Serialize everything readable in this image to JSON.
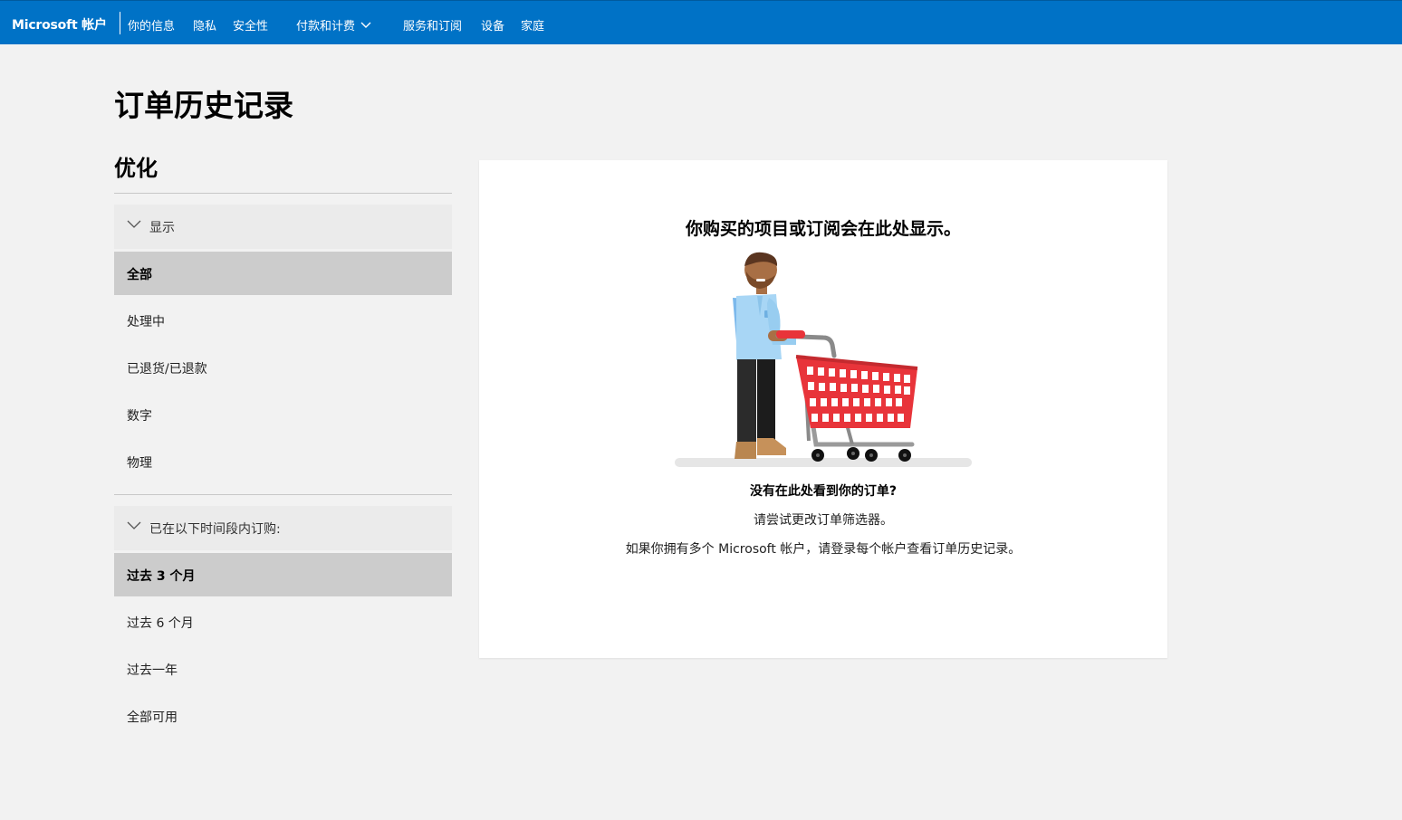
{
  "header": {
    "brand": "Microsoft 帐户",
    "nav": [
      "你的信息",
      "隐私",
      "安全性",
      "付款和计费",
      "服务和订阅",
      "设备",
      "家庭"
    ]
  },
  "page": {
    "title": "订单历史记录",
    "section_title": "优化"
  },
  "filters": {
    "display": {
      "label": "显示",
      "options": [
        "全部",
        "处理中",
        "已退货/已退款",
        "数字",
        "物理"
      ],
      "selected": "全部"
    },
    "period": {
      "label": "已在以下时间段内订购:",
      "options": [
        "过去 3 个月",
        "过去 6 个月",
        "过去一年",
        "全部可用"
      ],
      "selected": "过去 3 个月"
    }
  },
  "empty_state": {
    "heading": "你购买的项目或订阅会在此处显示。",
    "question": "没有在此处看到你的订单?",
    "hint": "请尝试更改订单筛选器。",
    "multi_account": "如果你拥有多个 Microsoft 帐户，请登录每个帐户查看订单历史记录。"
  },
  "colors": {
    "header_bg": "#0072c6",
    "page_bg": "#f2f2f2",
    "selected_bg": "#cccccc",
    "cart_red": "#e8343a"
  }
}
